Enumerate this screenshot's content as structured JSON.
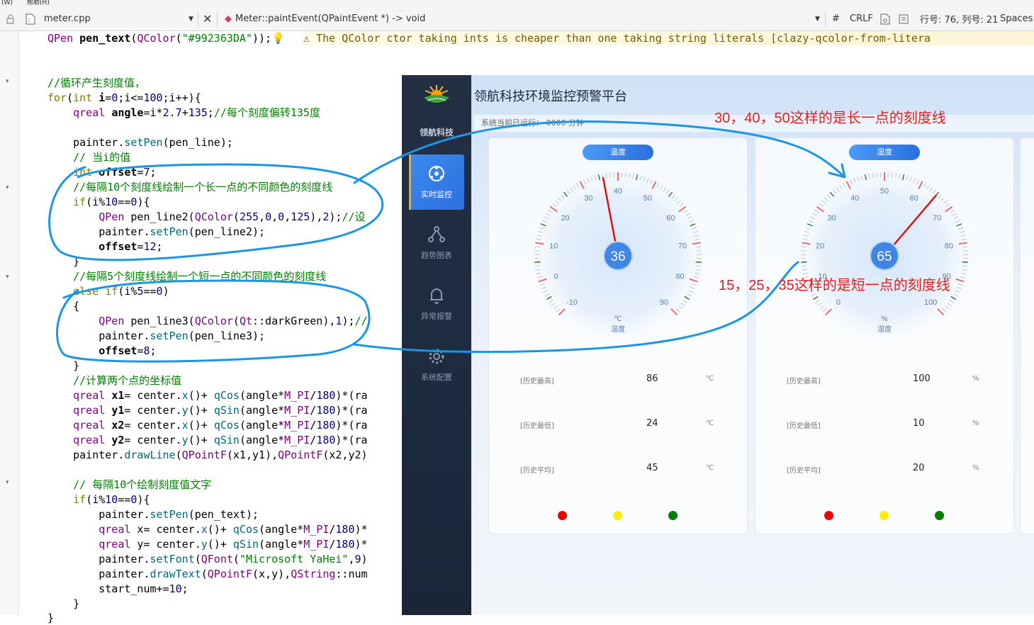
{
  "menu": {
    "items": [
      "(W)",
      "帮助(H)"
    ]
  },
  "tabbar": {
    "file": "meter.cpp",
    "function": "Meter::paintEvent(QPaintEvent *) -> void",
    "hash": "#",
    "line_ending": "CRLF",
    "position": "行号: 76, 列号: 21",
    "spaces": "Spaces:"
  },
  "code": {
    "warning": "⚠ The QColor ctor taking ints is cheaper than one taking string literals [clazy-qcolor-from-litera",
    "lines": [
      "QPen pen_text(QColor(\"#992363DA\"));",
      "",
      "//循环产生刻度值，",
      "for(int i=0;i<=100;i++){",
      "    qreal angle=i*2.7+135;//每个刻度偏转135度",
      "",
      "    painter.setPen(pen_line);",
      "    // 当i的值",
      "    int offset=7;",
      "    //每隔10个刻度线绘制一个长一点的不同颜色的刻度线",
      "    if(i%10==0){",
      "        QPen pen_line2(QColor(255,0,0,125),2);//设",
      "        painter.setPen(pen_line2);",
      "        offset=12;",
      "    }",
      "    //每隔5个刻度线绘制一个短一点的不同颜色的刻度线",
      "    else if(i%5==0)",
      "    {",
      "        QPen pen_line3(QColor(Qt::darkGreen),1);//",
      "        painter.setPen(pen_line3);",
      "        offset=8;",
      "    }",
      "    //计算两个点的坐标值",
      "    qreal x1= center.x()+ qCos(angle*M_PI/180)*(ra",
      "    qreal y1= center.y()+ qSin(angle*M_PI/180)*(ra",
      "    qreal x2= center.x()+ qCos(angle*M_PI/180)*(ra",
      "    qreal y2= center.y()+ qSin(angle*M_PI/180)*(ra",
      "    painter.drawLine(QPointF(x1,y1),QPointF(x2,y2)",
      "",
      "    // 每隔10个绘制刻度值文字",
      "    if(i%10==0){",
      "        painter.setPen(pen_text);",
      "        qreal x= center.x()+ qCos(angle*M_PI/180)*",
      "        qreal y= center.y()+ qSin(angle*M_PI/180)*",
      "        painter.setFont(QFont(\"Microsoft YaHei\",9)",
      "        painter.drawText(QPointF(x,y),QString::num",
      "        start_num+=10;",
      "    }",
      "}"
    ]
  },
  "app": {
    "title": "领航科技环境监控预警平台",
    "brand": "领航科技",
    "run_status": "系统当前已运行：  0000 分钟",
    "sidebar": [
      {
        "label": "实时监控",
        "icon": "monitor-icon",
        "active": true
      },
      {
        "label": "趋势图表",
        "icon": "share-icon",
        "active": false
      },
      {
        "label": "异常报警",
        "icon": "bell-icon",
        "active": false
      },
      {
        "label": "系统配置",
        "icon": "gear-icon",
        "active": false
      }
    ],
    "cards": [
      {
        "pill": "温度",
        "value": "36",
        "unit": "℃",
        "name": "温度",
        "min": -10,
        "max": 90,
        "labels": [
          "-10",
          "0",
          "10",
          "20",
          "30",
          "40",
          "50",
          "60",
          "70",
          "80",
          "90"
        ],
        "stats": [
          {
            "label": "[历史最高]",
            "value": "86",
            "unit": "℃"
          },
          {
            "label": "[历史最低]",
            "value": "24",
            "unit": "℃"
          },
          {
            "label": "[历史平均]",
            "value": "45",
            "unit": "℃"
          }
        ]
      },
      {
        "pill": "湿度",
        "value": "65",
        "unit": "%",
        "name": "湿度",
        "min": 0,
        "max": 100,
        "labels": [
          "0",
          "10",
          "20",
          "30",
          "40",
          "50",
          "60",
          "70",
          "80",
          "90",
          "100"
        ],
        "stats": [
          {
            "label": "[历史最高]",
            "value": "100",
            "unit": "%"
          },
          {
            "label": "[历史最低]",
            "value": "10",
            "unit": "%"
          },
          {
            "label": "[历史平均]",
            "value": "20",
            "unit": "%"
          }
        ]
      }
    ],
    "status_colors": [
      "#ee0000",
      "#ffee00",
      "#008000"
    ]
  },
  "annotations": {
    "long_tick": "30，40，50这样的是长一点的刻度线",
    "short_tick": "15，25，35这样的是短一点的刻度线",
    "color": "#e02020",
    "stroke_color": "#1a96e8"
  }
}
